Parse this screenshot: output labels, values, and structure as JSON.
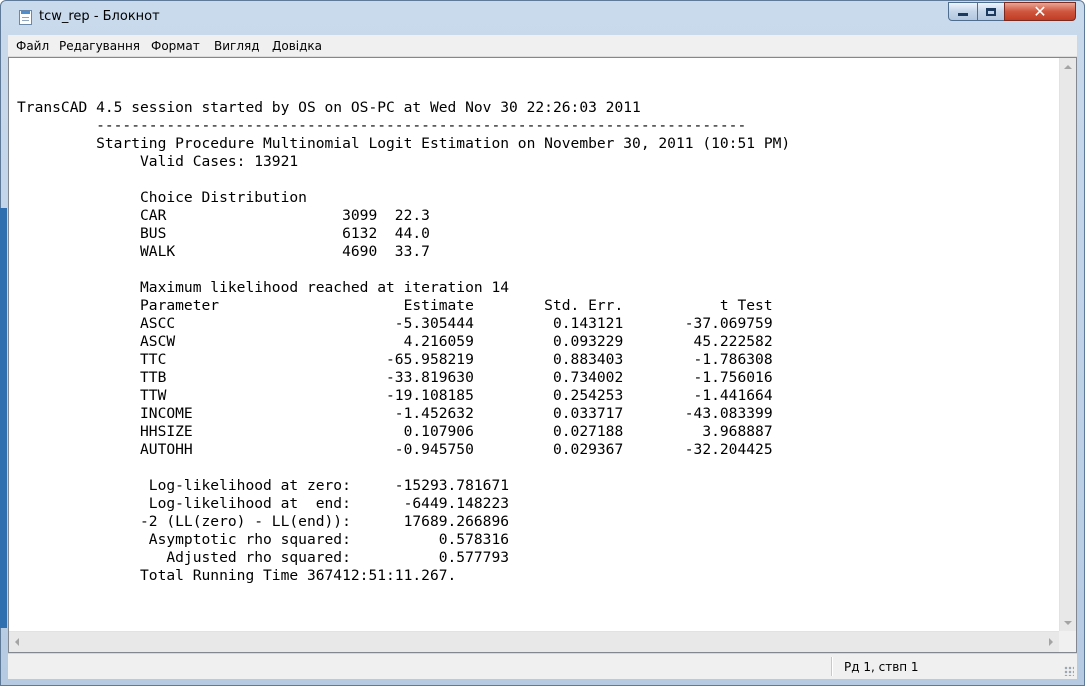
{
  "window": {
    "title": "tcw_rep - Блокнот",
    "close_glyph": "✕"
  },
  "menu": {
    "items": [
      {
        "label": "Файл"
      },
      {
        "label": "Редагування"
      },
      {
        "label": "Формат"
      },
      {
        "label": "Вигляд"
      },
      {
        "label": "Довідка"
      }
    ]
  },
  "document": {
    "content": "TransCAD 4.5 session started by OS on OS-PC at Wed Nov 30 22:26:03 2011\n         --------------------------------------------------------------------------\n         Starting Procedure Multinomial Logit Estimation on November 30, 2011 (10:51 PM)\n              Valid Cases: 13921\n\n              Choice Distribution\n              CAR                    3099  22.3\n              BUS                    6132  44.0\n              WALK                   4690  33.7\n\n              Maximum likelihood reached at iteration 14\n              Parameter                     Estimate        Std. Err.           t Test\n              ASCC                         -5.305444         0.143121       -37.069759\n              ASCW                          4.216059         0.093229        45.222582\n              TTC                         -65.958219         0.883403        -1.786308\n              TTB                         -33.819630         0.734002        -1.756016\n              TTW                         -19.108185         0.254253        -1.441664\n              INCOME                       -1.452632         0.033717       -43.083399\n              HHSIZE                        0.107906         0.027188         3.968887\n              AUTOHH                       -0.945750         0.029367       -32.204425\n\n               Log-likelihood at zero:     -15293.781671\n               Log-likelihood at  end:      -6449.148223\n              -2 (LL(zero) - LL(end)):      17689.266896\n               Asymptotic rho squared:          0.578316\n                 Adjusted rho squared:          0.577793\n              Total Running Time 367412:51:11.267."
  },
  "status": {
    "position": "Рд 1, ствп 1"
  },
  "icons": {
    "app": "notepad-icon",
    "minimize": "minimize-icon",
    "maximize": "maximize-icon",
    "close": "close-icon"
  }
}
